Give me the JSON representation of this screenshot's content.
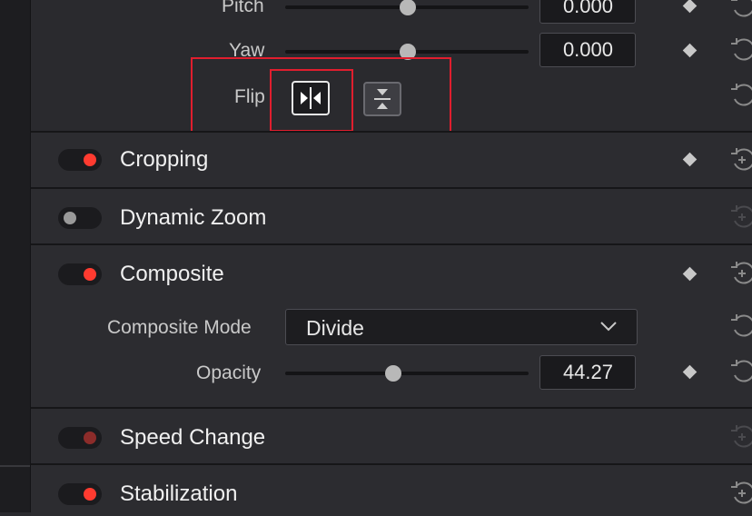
{
  "transform": {
    "pitch": {
      "label": "Pitch",
      "value": "0.000",
      "slider_fraction": 0.5
    },
    "yaw": {
      "label": "Yaw",
      "value": "0.000",
      "slider_fraction": 0.5
    },
    "flip": {
      "label": "Flip",
      "horizontal_icon": "flip-horizontal-icon",
      "vertical_icon": "flip-vertical-icon"
    }
  },
  "sections": {
    "cropping": {
      "title": "Cropping",
      "enabled": true
    },
    "dynamic_zoom": {
      "title": "Dynamic Zoom",
      "enabled": false
    },
    "composite": {
      "title": "Composite",
      "enabled": true
    },
    "speed_change": {
      "title": "Speed Change",
      "enabled": true
    },
    "stabilization": {
      "title": "Stabilization",
      "enabled": true
    }
  },
  "composite": {
    "mode_label": "Composite Mode",
    "mode_value": "Divide",
    "opacity_label": "Opacity",
    "opacity_value": "44.27",
    "opacity_fraction": 0.44
  },
  "colors": {
    "accent_on": "#ff3b30",
    "highlight": "#e01e2e"
  }
}
